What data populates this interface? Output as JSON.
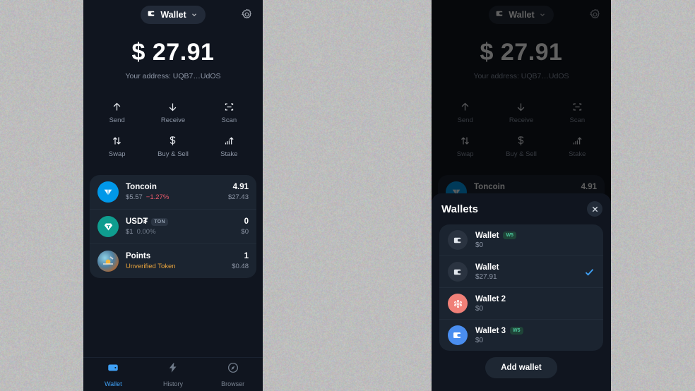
{
  "background": {
    "color": "#bdbdbd"
  },
  "app": {
    "theme": {
      "bg": "#10151f",
      "card": "#1b2430",
      "accent": "#3fa0f5",
      "down": "#e8596a",
      "warn": "#e8a33d",
      "verified_badge": "#4cc49a"
    }
  },
  "header": {
    "wallet_chip_label": "Wallet",
    "wallet_icon": "wallet-icon",
    "chevron_icon": "chevron-down-icon",
    "settings_icon": "gear-icon"
  },
  "balance": {
    "amount": "$ 27.91",
    "address_label": "Your address: UQB7…UdOS"
  },
  "actions": [
    {
      "label": "Send",
      "icon": "arrow-up-icon"
    },
    {
      "label": "Receive",
      "icon": "arrow-down-icon"
    },
    {
      "label": "Scan",
      "icon": "scan-frame-icon"
    },
    {
      "label": "Swap",
      "icon": "swap-arrows-icon"
    },
    {
      "label": "Buy & Sell",
      "icon": "dollar-sign-icon"
    },
    {
      "label": "Stake",
      "icon": "chart-arrow-up-icon"
    }
  ],
  "tokens": [
    {
      "name": "Toncoin",
      "badge": "",
      "price": "$5.57",
      "change": "−1.27%",
      "change_state": "down",
      "amount": "4.91",
      "fiat": "$27.43",
      "icon": "toncoin-icon",
      "icon_color": "#0098e9"
    },
    {
      "name": "USD₮",
      "badge": "TON",
      "price": "$1",
      "change": "0.00%",
      "change_state": "flat",
      "amount": "0",
      "fiat": "$0",
      "icon": "usdt-icon",
      "icon_color": "#0f9d8f"
    },
    {
      "name": "Points",
      "badge": "",
      "price": "Unverified Token",
      "change": "",
      "change_state": "warn",
      "amount": "1",
      "fiat": "$0.48",
      "icon": "points-token-icon",
      "icon_color": "#7fa8c4"
    }
  ],
  "bottom_nav": [
    {
      "label": "Wallet",
      "icon": "wallet-nav-icon",
      "active": true
    },
    {
      "label": "History",
      "icon": "history-bolt-icon",
      "active": false
    },
    {
      "label": "Browser",
      "icon": "compass-icon",
      "active": false
    }
  ],
  "wallets_modal": {
    "title": "Wallets",
    "close_icon": "close-icon",
    "add_button_label": "Add wallet",
    "items": [
      {
        "name": "Wallet",
        "badge": "W5",
        "balance": "$0",
        "selected": false,
        "avatar": "wallet-icon",
        "avatar_style": "dark"
      },
      {
        "name": "Wallet",
        "badge": "",
        "balance": "$27.91",
        "selected": true,
        "avatar": "wallet-icon",
        "avatar_style": "dark"
      },
      {
        "name": "Wallet 2",
        "badge": "",
        "balance": "$0",
        "selected": false,
        "avatar": "flower-dots-icon",
        "avatar_style": "red"
      },
      {
        "name": "Wallet 3",
        "badge": "W5",
        "balance": "$0",
        "selected": false,
        "avatar": "wallet-icon",
        "avatar_style": "blue"
      }
    ]
  }
}
